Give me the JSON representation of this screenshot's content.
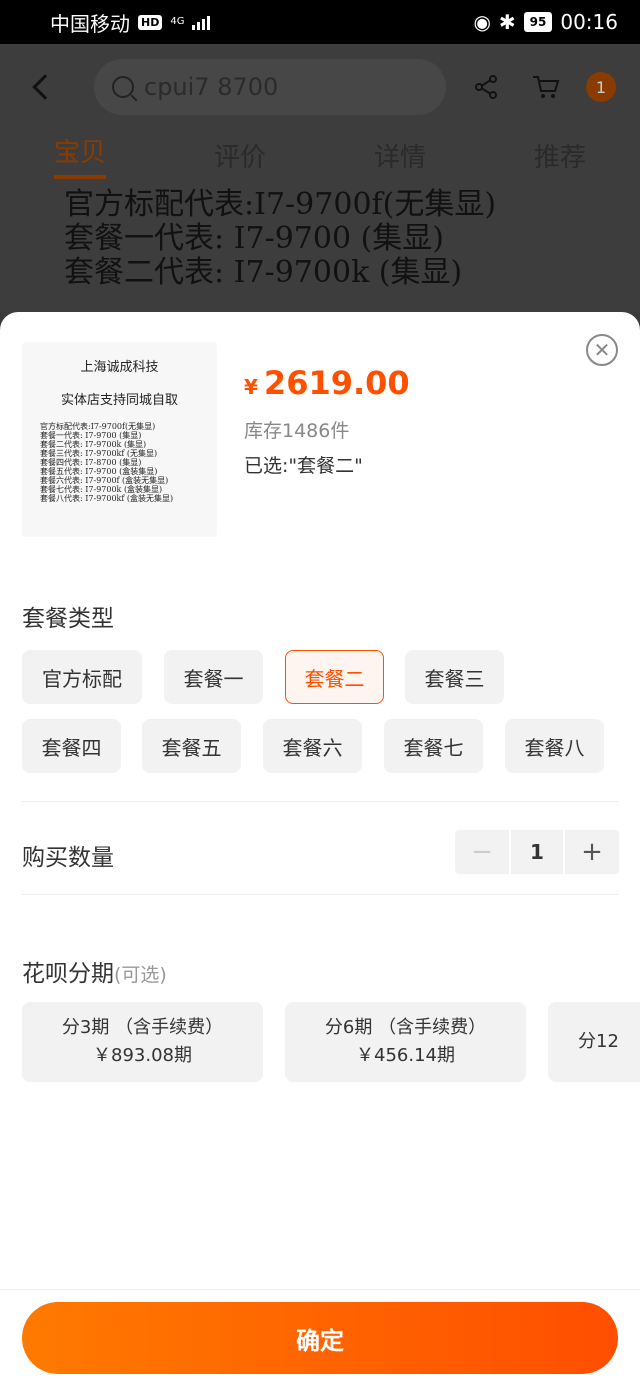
{
  "status_bar": {
    "carrier": "中国移动",
    "hd": "HD",
    "network": "4G",
    "battery": "95",
    "time": "00:16"
  },
  "background": {
    "search_text": "cpui7 8700",
    "cart_badge": "1",
    "tabs": [
      "宝贝",
      "评价",
      "详情",
      "推荐"
    ],
    "desc_lines": [
      "官方标配代表:I7-9700f(无集显)",
      "套餐一代表: I7-9700 (集显)",
      "套餐二代表: I7-9700k (集显)"
    ]
  },
  "product": {
    "thumb_line1": "上海诚成科技",
    "thumb_line2": "实体店支持同城自取",
    "thumb_list": [
      "官方标配代表:I7-9700f(无集显)",
      "套餐一代表: I7-9700 (集显)",
      "套餐二代表: I7-9700k (集显)",
      "套餐三代表: I7-9700kf (无集显)",
      "套餐四代表: I7-8700 (集显)",
      "套餐五代表: I7-9700 (盒装集显)",
      "套餐六代表: I7-9700f (盒装无集显)",
      "套餐七代表: I7-9700k (盒装集显)",
      "套餐八代表: I7-9700kf (盒装无集显)"
    ],
    "currency": "¥",
    "price": "2619.00",
    "stock": "库存1486件",
    "selected": "已选:\"套餐二\""
  },
  "package": {
    "title": "套餐类型",
    "options": [
      "官方标配",
      "套餐一",
      "套餐二",
      "套餐三",
      "套餐四",
      "套餐五",
      "套餐六",
      "套餐七",
      "套餐八"
    ],
    "selected_index": 2
  },
  "quantity": {
    "title": "购买数量",
    "minus": "−",
    "value": "1",
    "plus": "+"
  },
  "installment": {
    "title": "花呗分期",
    "optional": "(可选)",
    "cards": [
      {
        "label": "分3期 （含手续费）",
        "amount": "￥893.08期"
      },
      {
        "label": "分6期 （含手续费）",
        "amount": "￥456.14期"
      },
      {
        "label": "分12",
        "amount": ""
      }
    ]
  },
  "confirm_label": "确定",
  "colors": {
    "accent": "#ff5000",
    "button_gradient_start": "#ff7a00",
    "button_gradient_end": "#ff4e00",
    "option_bg": "#f2f2f2"
  }
}
